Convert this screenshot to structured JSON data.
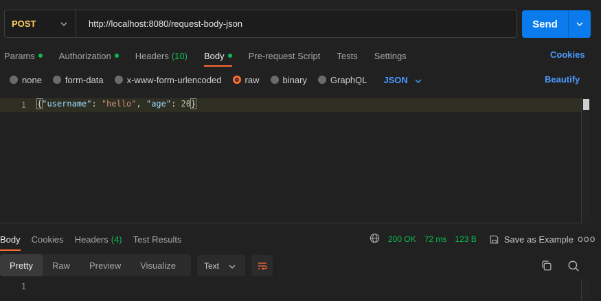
{
  "request": {
    "method": "POST",
    "url": "http://localhost:8080/request-body-json",
    "send_label": "Send"
  },
  "tabs": [
    {
      "label": "Params"
    },
    {
      "label": "Authorization"
    },
    {
      "label": "Headers",
      "count": "(10)"
    },
    {
      "label": "Body"
    },
    {
      "label": "Pre-request Script"
    },
    {
      "label": "Tests"
    },
    {
      "label": "Settings"
    }
  ],
  "cookies_label": "Cookies",
  "body_types": [
    "none",
    "form-data",
    "x-www-form-urlencoded",
    "raw",
    "binary",
    "GraphQL"
  ],
  "selected_body_type": "raw",
  "format": "JSON",
  "beautify_label": "Beautify",
  "editor": {
    "line_number": "1",
    "key1": "\"username\"",
    "val1": "\"hello\"",
    "key2": "\"age\"",
    "val2": "20"
  },
  "response": {
    "tabs": [
      {
        "label": "Body"
      },
      {
        "label": "Cookies"
      },
      {
        "label": "Headers",
        "count": "(4)"
      },
      {
        "label": "Test Results"
      }
    ],
    "status": "200 OK",
    "time": "72 ms",
    "size": "123 B",
    "save_label": "Save as Example",
    "more": "ooo",
    "views": [
      "Pretty",
      "Raw",
      "Preview",
      "Visualize"
    ],
    "text_format": "Text",
    "line_number": "1"
  },
  "colors": {
    "accent_orange": "#ff6c37",
    "send_blue": "#097bed",
    "link_blue": "#4b9bff",
    "ok_green": "#0cbb52",
    "method_yellow": "#ffd15c"
  }
}
